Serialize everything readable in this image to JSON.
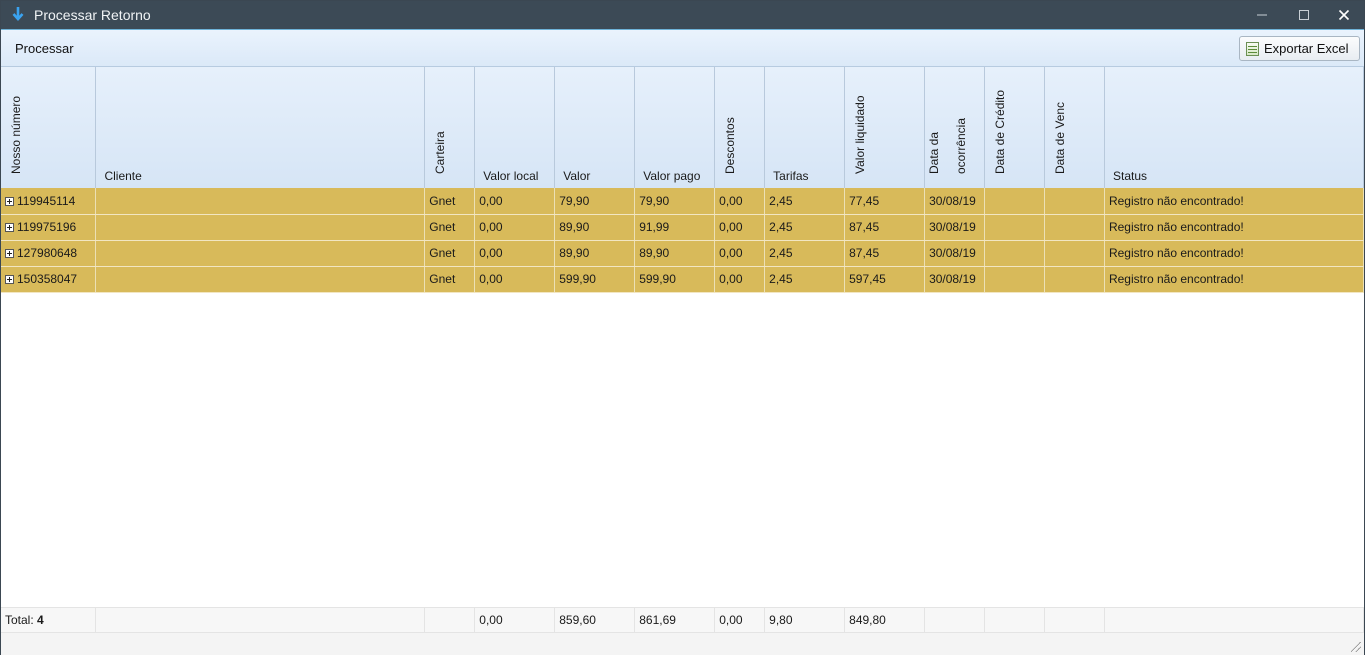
{
  "window": {
    "title": "Processar Retorno",
    "accent": "#3c4a56"
  },
  "toolbar": {
    "menu_label": "Processar",
    "export_label": "Exportar Excel"
  },
  "columns": {
    "nosso_numero": "Nosso número",
    "cliente": "Cliente",
    "carteira": "Carteira",
    "valor_local": "Valor local",
    "valor": "Valor",
    "valor_pago": "Valor pago",
    "descontos": "Descontos",
    "tarifas": "Tarifas",
    "valor_liquidado": "Valor liquidado",
    "data_ocorrencia_1": "Data da",
    "data_ocorrencia_2": "ocorrência",
    "data_credito": "Data de Crédito",
    "data_venc": "Data de Venc",
    "status": "Status"
  },
  "rows": [
    {
      "nosso_numero": "119945114",
      "cliente": "",
      "carteira": "Gnet",
      "valor_local": "0,00",
      "valor": "79,90",
      "valor_pago": "79,90",
      "descontos": "0,00",
      "tarifas": "2,45",
      "valor_liquidado": "77,45",
      "data_ocorrencia": "30/08/19",
      "data_credito": "",
      "data_venc": "",
      "status": "Registro não encontrado!"
    },
    {
      "nosso_numero": "119975196",
      "cliente": "",
      "carteira": "Gnet",
      "valor_local": "0,00",
      "valor": "89,90",
      "valor_pago": "91,99",
      "descontos": "0,00",
      "tarifas": "2,45",
      "valor_liquidado": "87,45",
      "data_ocorrencia": "30/08/19",
      "data_credito": "",
      "data_venc": "",
      "status": "Registro não encontrado!"
    },
    {
      "nosso_numero": "127980648",
      "cliente": "",
      "carteira": "Gnet",
      "valor_local": "0,00",
      "valor": "89,90",
      "valor_pago": "89,90",
      "descontos": "0,00",
      "tarifas": "2,45",
      "valor_liquidado": "87,45",
      "data_ocorrencia": "30/08/19",
      "data_credito": "",
      "data_venc": "",
      "status": "Registro não encontrado!"
    },
    {
      "nosso_numero": "150358047",
      "cliente": "",
      "carteira": "Gnet",
      "valor_local": "0,00",
      "valor": "599,90",
      "valor_pago": "599,90",
      "descontos": "0,00",
      "tarifas": "2,45",
      "valor_liquidado": "597,45",
      "data_ocorrencia": "30/08/19",
      "data_credito": "",
      "data_venc": "",
      "status": "Registro não encontrado!"
    }
  ],
  "row_color": "#d8ba5a",
  "totals": {
    "label": "Total:",
    "count": "4",
    "valor_local": "0,00",
    "valor": "859,60",
    "valor_pago": "861,69",
    "descontos": "0,00",
    "tarifas": "9,80",
    "valor_liquidado": "849,80"
  },
  "icons": {
    "app": "download-arrow-icon",
    "export": "excel-icon",
    "expand": "plus-box-icon",
    "resize": "resize-grip-icon"
  }
}
